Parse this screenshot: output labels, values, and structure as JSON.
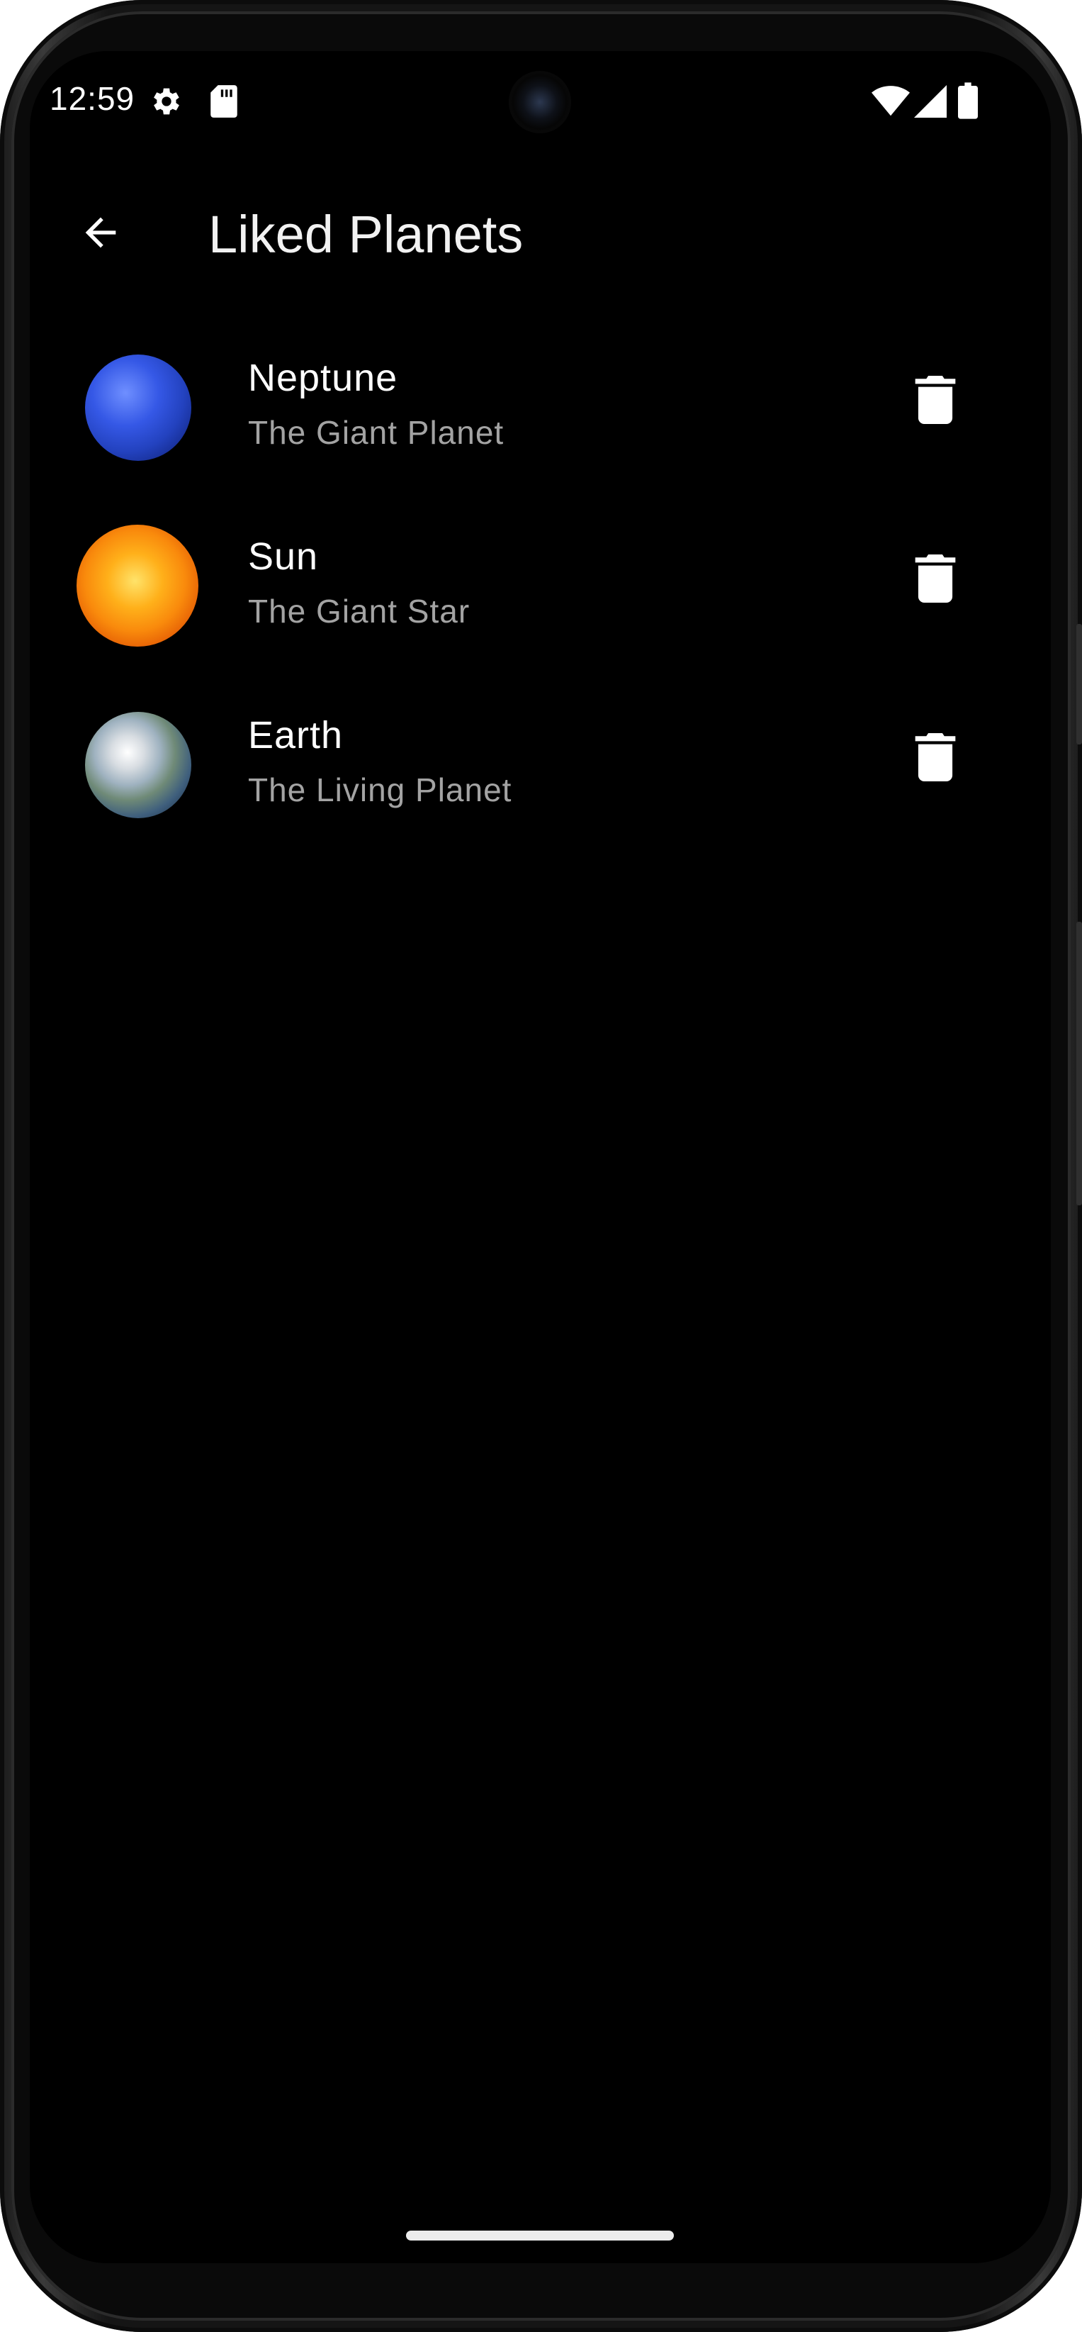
{
  "status_bar": {
    "time": "12:59",
    "icons": [
      "gear-icon",
      "sd-card-icon",
      "wifi-icon",
      "cellular-signal-icon",
      "battery-icon"
    ]
  },
  "app_bar": {
    "back_icon": "arrow-back-icon",
    "title": "Liked Planets"
  },
  "planets": [
    {
      "name": "Neptune",
      "subtitle": "The Giant Planet",
      "image": "neptune",
      "action_icon": "trash-icon"
    },
    {
      "name": "Sun",
      "subtitle": "The Giant Star",
      "image": "sun",
      "action_icon": "trash-icon"
    },
    {
      "name": "Earth",
      "subtitle": "The Living Planet",
      "image": "earth",
      "action_icon": "trash-icon"
    }
  ],
  "colors": {
    "background": "#000000",
    "text_primary": "#ffffff",
    "text_secondary": "#a3a3a3"
  }
}
